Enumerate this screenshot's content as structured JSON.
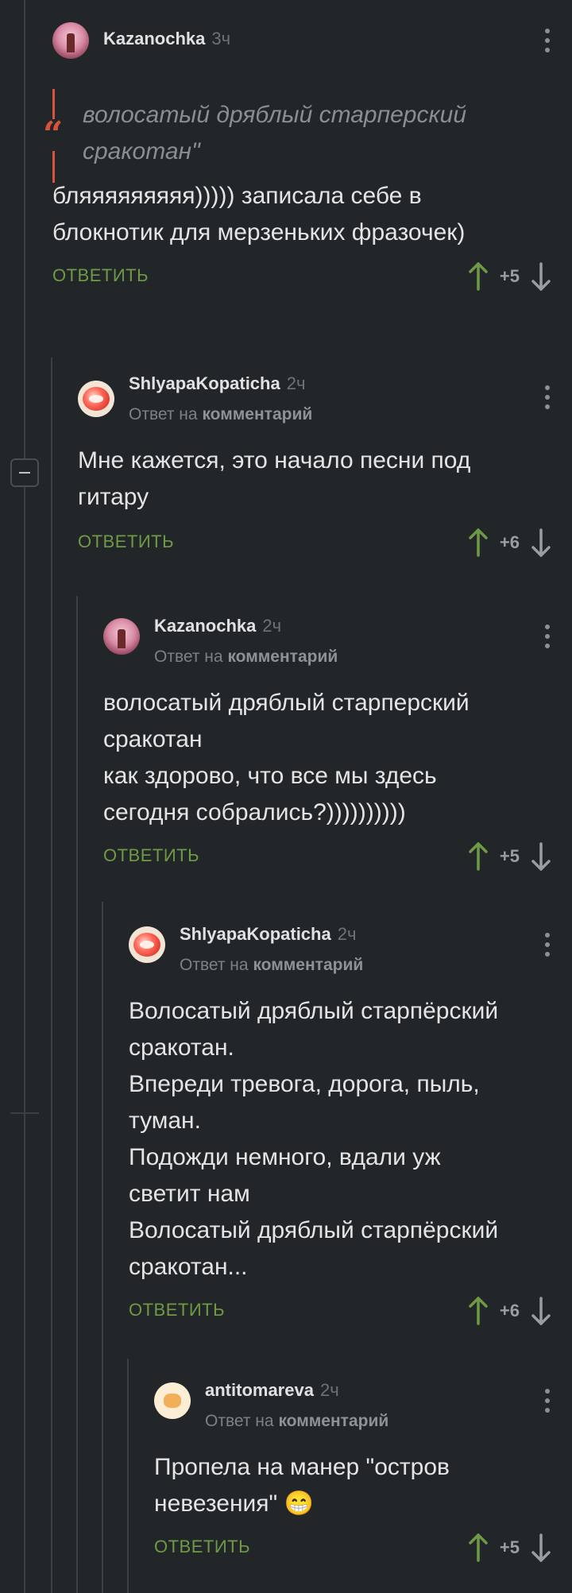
{
  "comments": [
    {
      "user": "Kazanochka",
      "time": "3ч",
      "quote": "волосатый дряблый старперский\nсракотан\"",
      "text": " бляяяяяяяяя))))) записала себе в\nблокнотик для мерзеньких фразочек)",
      "reply_label": "ОТВЕТИТЬ",
      "score": "+5"
    },
    {
      "user": "ShlyapaKopaticha",
      "time": "2ч",
      "reply_prefix": "Ответ на",
      "reply_target": "комментарий",
      "text": "Мне кажется, это начало песни под\nгитару",
      "reply_label": "ОТВЕТИТЬ",
      "score": "+6"
    },
    {
      "user": "Kazanochka",
      "time": "2ч",
      "reply_prefix": "Ответ на",
      "reply_target": "комментарий",
      "text": "волосатый дряблый старперский\nсракотан\nкак здорово, что все мы здесь\nсегодня собрались?))))))))))",
      "reply_label": "ОТВЕТИТЬ",
      "score": "+5"
    },
    {
      "user": "ShlyapaKopaticha",
      "time": "2ч",
      "reply_prefix": "Ответ на",
      "reply_target": "комментарий",
      "text": "Волосатый дряблый старпёрский\nсракотан.\nВпереди тревога, дорога, пыль,\nтуман.\nПодожди немного, вдали уж\nсветит нам\nВолосатый дряблый старпёрский\nсракотан...",
      "reply_label": "ОТВЕТИТЬ",
      "score": "+6"
    },
    {
      "user": "antitomareva",
      "time": "2ч",
      "reply_prefix": "Ответ на",
      "reply_target": "комментарий",
      "text": "Пропела на манер \"остров\nневезения\" 😁",
      "reply_label": "ОТВЕТИТЬ",
      "score": "+5"
    }
  ],
  "colors": {
    "background": "#232628",
    "accent_green": "#6e9a46",
    "quote_red": "#d9533a"
  }
}
